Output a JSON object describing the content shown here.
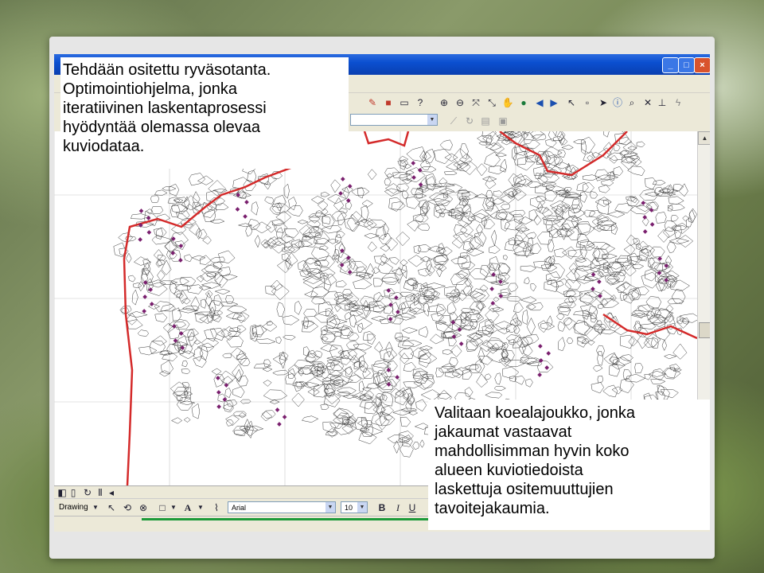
{
  "callouts": {
    "top": {
      "lines": [
        "Tehdään ositettu ryväsotanta.",
        "Optimointiohjelma, jonka",
        "iteratiivinen laskentaprosessi",
        "hyödyntää olemassa olevaa",
        "kuviodataa."
      ]
    },
    "bottom": {
      "lines": [
        "Valitaan koealajoukko, jonka",
        "jakaumat vastaavat",
        "mahdollisimman hyvin koko",
        "alueen kuviotiedoista",
        "laskettuja ositemuuttujien",
        "tavoitejakaumia."
      ]
    }
  },
  "window": {
    "controls": {
      "minimize": "_",
      "maximize": "□",
      "close": "×"
    }
  },
  "drawing_toolbar": {
    "drawing_label": "Drawing",
    "font_name": "Arial",
    "font_size": "10",
    "bold": "B",
    "italic": "I",
    "underline": "U",
    "text_tool": "A"
  },
  "colors": {
    "boundary": "#d42a2a",
    "sample_point": "#7a1f6e",
    "title_bar": "#0b4fd0",
    "status_accent": "#1e9a3a"
  },
  "icons": [
    "zoom-in-icon",
    "zoom-out-icon",
    "pan-icon",
    "globe-icon",
    "back-icon",
    "forward-icon",
    "select-icon",
    "info-icon",
    "find-icon",
    "help-icon",
    "measure-icon",
    "lightning-icon"
  ]
}
